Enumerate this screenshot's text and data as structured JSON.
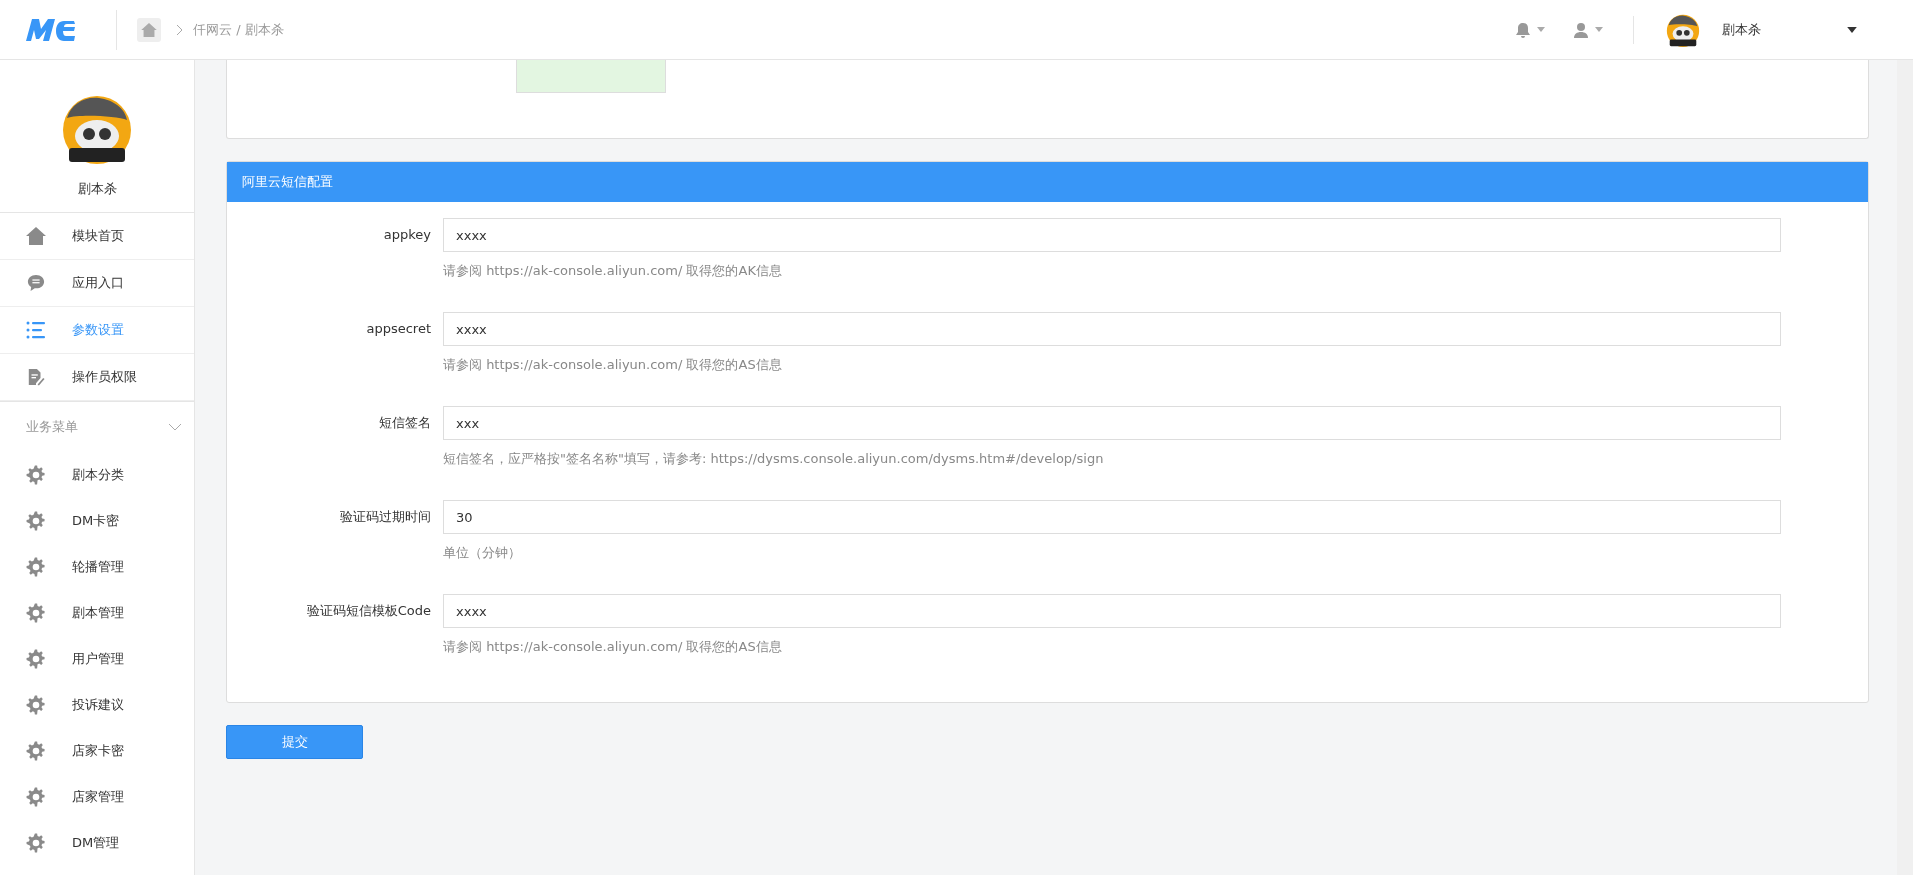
{
  "header": {
    "breadcrumb": "仟网云 / 剧本杀",
    "user_name": "剧本杀"
  },
  "sidebar": {
    "account_name": "剧本杀",
    "items": [
      {
        "label": "模块首页",
        "kind": "home",
        "selected": false
      },
      {
        "label": "应用入口",
        "kind": "chat",
        "selected": false
      },
      {
        "label": "参数设置",
        "kind": "list",
        "selected": true
      },
      {
        "label": "操作员权限",
        "kind": "doc",
        "selected": false
      }
    ],
    "section": {
      "title": "业务菜单",
      "expanded": true,
      "items": [
        {
          "label": "剧本分类",
          "selected": false
        },
        {
          "label": "DM卡密",
          "selected": false
        },
        {
          "label": "轮播管理",
          "selected": false
        },
        {
          "label": "剧本管理",
          "selected": false
        },
        {
          "label": "用户管理",
          "selected": false
        },
        {
          "label": "投诉建议",
          "selected": false
        },
        {
          "label": "店家卡密",
          "selected": false
        },
        {
          "label": "店家管理",
          "selected": false
        },
        {
          "label": "DM管理",
          "selected": false
        }
      ]
    }
  },
  "panel": {
    "title": "阿里云短信配置",
    "fields": [
      {
        "label": "appkey",
        "value": "xxxx",
        "help": "请参阅 https://ak-console.aliyun.com/ 取得您的AK信息"
      },
      {
        "label": "appsecret",
        "value": "xxxx",
        "help": "请参阅 https://ak-console.aliyun.com/ 取得您的AS信息"
      },
      {
        "label": "短信签名",
        "value": "xxx",
        "help": "短信签名，应严格按\"签名名称\"填写，请参考: https://dysms.console.aliyun.com/dysms.htm#/develop/sign"
      },
      {
        "label": "验证码过期时间",
        "value": "30",
        "help": "单位（分钟）"
      },
      {
        "label": "验证码短信模板Code",
        "value": "xxxx",
        "help": "请参阅 https://ak-console.aliyun.com/ 取得您的AS信息"
      }
    ]
  },
  "submit_button": "提交"
}
